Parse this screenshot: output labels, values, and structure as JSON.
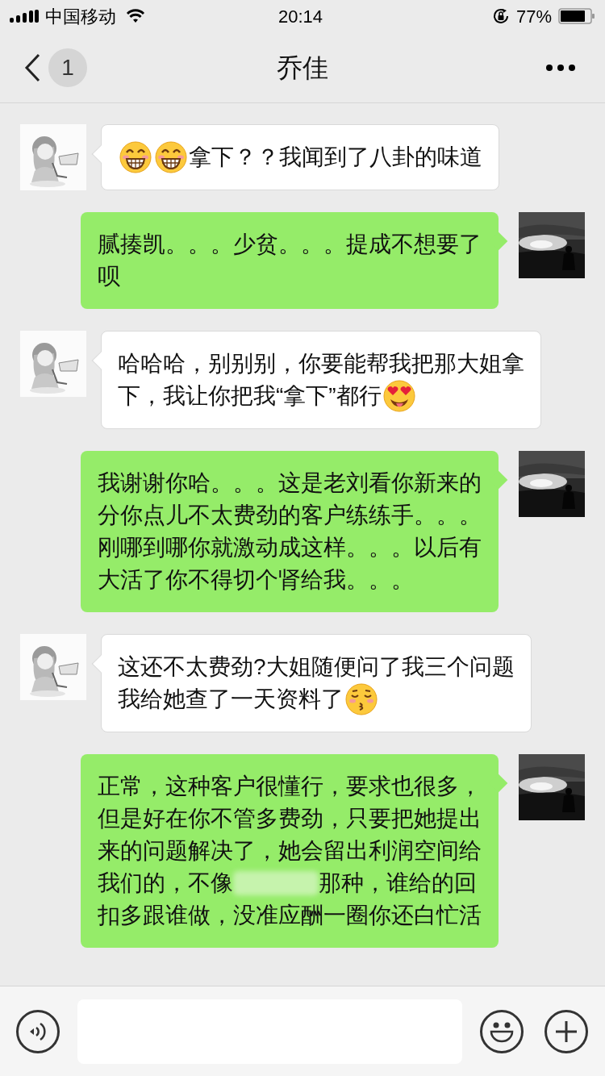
{
  "status_bar": {
    "carrier": "中国移动",
    "time": "20:14",
    "battery": "77%"
  },
  "nav": {
    "back_count": "1",
    "title": "乔佳"
  },
  "messages": [
    {
      "kind": "received",
      "lines": [
        [
          {
            "kind": "grin"
          },
          {
            "kind": "grin"
          },
          {
            "kind": "text",
            "text": "拿下？？我闻到了八卦的味道"
          }
        ]
      ]
    },
    {
      "kind": "sent",
      "lines": [
        [
          {
            "kind": "text",
            "text": "腻揍凯。。。少贫。。。提成不想要了"
          }
        ],
        [
          {
            "kind": "text",
            "text": "呗"
          }
        ]
      ]
    },
    {
      "kind": "received",
      "lines": [
        [
          {
            "kind": "text",
            "text": "哈哈哈，别别别，你要能帮我把那大姐拿"
          }
        ],
        [
          {
            "kind": "text",
            "text": "下，我让你把我“拿下”都行"
          },
          {
            "kind": "heart_eyes"
          }
        ]
      ]
    },
    {
      "kind": "sent",
      "lines": [
        [
          {
            "kind": "text",
            "text": "我谢谢你哈。。。这是老刘看你新来的"
          }
        ],
        [
          {
            "kind": "text",
            "text": "分你点儿不太费劲的客户练练手。。。"
          }
        ],
        [
          {
            "kind": "text",
            "text": "刚哪到哪你就激动成这样。。。以后有"
          }
        ],
        [
          {
            "kind": "text",
            "text": "大活了你不得切个肾给我。。。"
          }
        ]
      ]
    },
    {
      "kind": "received",
      "lines": [
        [
          {
            "kind": "text",
            "text": "这还不太费劲?大姐随便问了我三个问题"
          }
        ],
        [
          {
            "kind": "text",
            "text": "我给她查了一天资料了"
          },
          {
            "kind": "kiss"
          }
        ]
      ]
    },
    {
      "kind": "sent",
      "lines": [
        [
          {
            "kind": "text",
            "text": "正常，这种客户很懂行，要求也很多，"
          }
        ],
        [
          {
            "kind": "text",
            "text": "但是好在你不管多费劲，只要把她提出"
          }
        ],
        [
          {
            "kind": "text",
            "text": "来的问题解决了，她会留出利润空间给"
          }
        ],
        [
          {
            "kind": "text",
            "text": "我们的，不像"
          },
          {
            "kind": "blur"
          },
          {
            "kind": "text",
            "text": "那种，谁给的回"
          }
        ],
        [
          {
            "kind": "text",
            "text": "扣多跟谁做，没准应酬一圈你还白忙活"
          }
        ]
      ]
    }
  ]
}
